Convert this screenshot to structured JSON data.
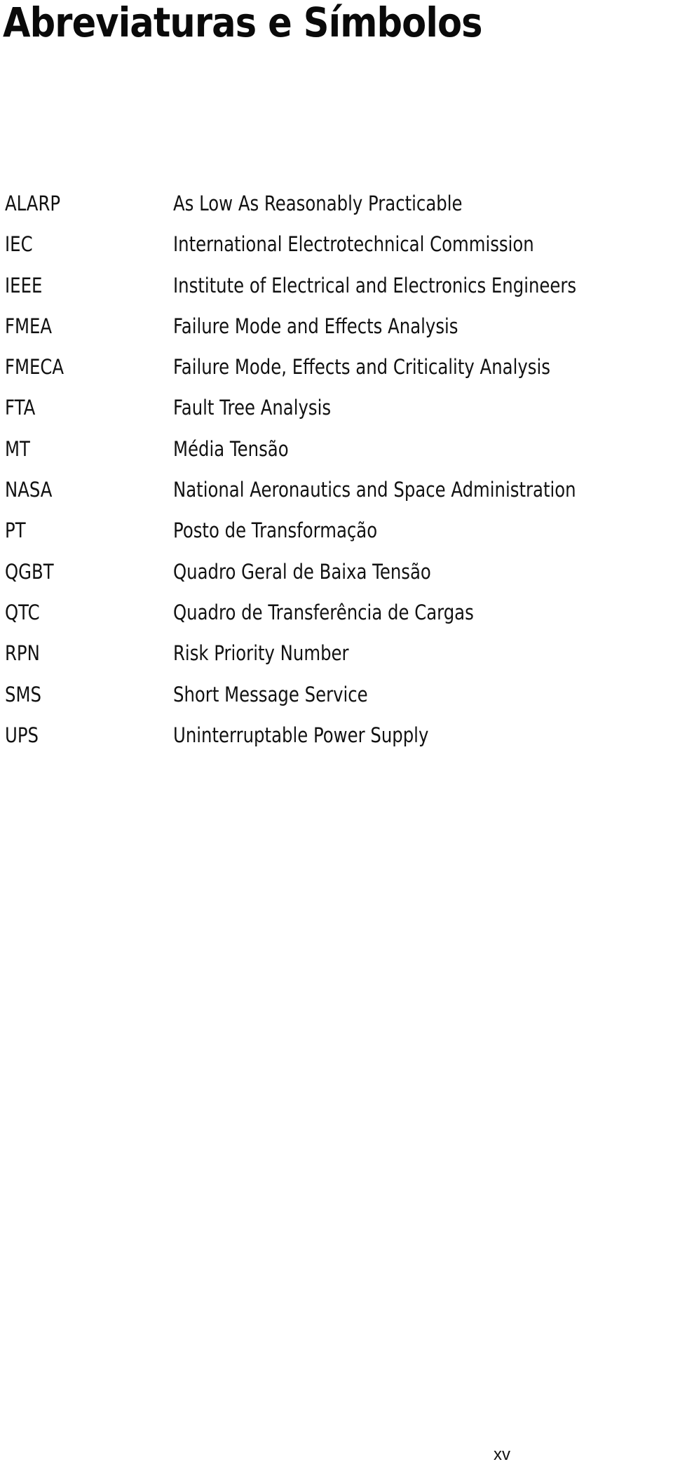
{
  "page": {
    "title": "Abreviaturas e Símbolos",
    "page_number": "xv"
  },
  "abbreviations": [
    {
      "abbr": "ALARP",
      "definition": "As Low As Reasonably Practicable"
    },
    {
      "abbr": "IEC",
      "definition": "International Electrotechnical Commission"
    },
    {
      "abbr": "IEEE",
      "definition": "Institute of Electrical and Electronics Engineers"
    },
    {
      "abbr": "FMEA",
      "definition": "Failure Mode and Effects Analysis"
    },
    {
      "abbr": "FMECA",
      "definition": "Failure Mode, Effects and Criticality Analysis"
    },
    {
      "abbr": "FTA",
      "definition": "Fault Tree Analysis"
    },
    {
      "abbr": "MT",
      "definition": "Média Tensão"
    },
    {
      "abbr": "NASA",
      "definition": "National Aeronautics and Space Administration"
    },
    {
      "abbr": "PT",
      "definition": "Posto de Transformação"
    },
    {
      "abbr": "QGBT",
      "definition": "Quadro Geral de Baixa Tensão"
    },
    {
      "abbr": "QTC",
      "definition": "Quadro de Transferência de Cargas"
    },
    {
      "abbr": "RPN",
      "definition": "Risk Priority Number"
    },
    {
      "abbr": "SMS",
      "definition": "Short Message Service"
    },
    {
      "abbr": "UPS",
      "definition": "Uninterruptable Power Supply"
    }
  ]
}
